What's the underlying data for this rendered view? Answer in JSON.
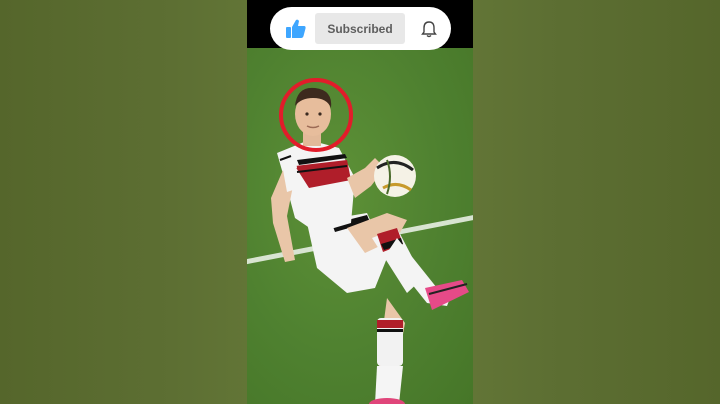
{
  "overlay": {
    "subscribe_label": "Subscribed",
    "like_icon": "thumbs-up-icon",
    "bell_icon": "bell-icon",
    "accent_color": "#3ea6ff",
    "highlight_color": "#e21c2a"
  }
}
